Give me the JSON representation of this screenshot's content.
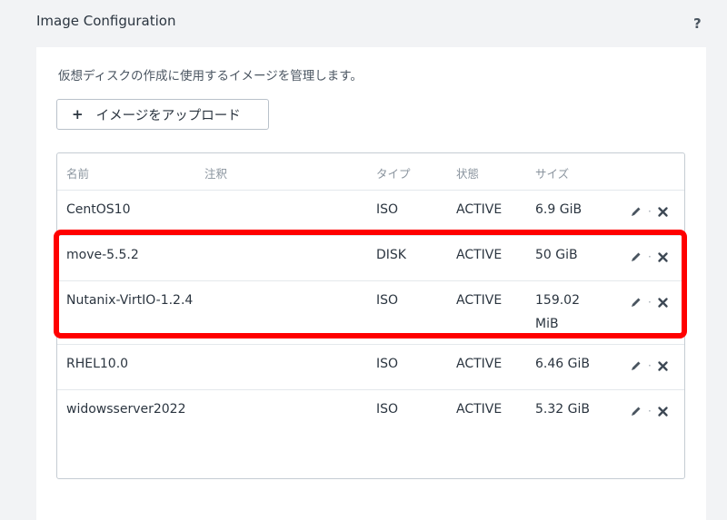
{
  "header": {
    "title": "Image Configuration",
    "help": "?"
  },
  "panel": {
    "description": "仮想ディスクの作成に使用するイメージを管理します。",
    "upload_button": {
      "icon": "plus-icon",
      "plus": "+",
      "label": "イメージをアップロード"
    }
  },
  "table": {
    "columns": {
      "name": "名前",
      "note": "注釈",
      "type": "タイプ",
      "state": "状態",
      "size": "サイズ"
    },
    "rows": [
      {
        "name": "CentOS10",
        "note": "",
        "type": "ISO",
        "state": "ACTIVE",
        "size_line1": "6.9 GiB",
        "size_line2": ""
      },
      {
        "name": "move-5.5.2",
        "note": "",
        "type": "DISK",
        "state": "ACTIVE",
        "size_line1": "50 GiB",
        "size_line2": ""
      },
      {
        "name": "Nutanix-VirtIO-1.2.4",
        "note": "",
        "type": "ISO",
        "state": "ACTIVE",
        "size_line1": "159.02",
        "size_line2": "MiB"
      },
      {
        "name": "RHEL10.0",
        "note": "",
        "type": "ISO",
        "state": "ACTIVE",
        "size_line1": "6.46 GiB",
        "size_line2": ""
      },
      {
        "name": "widowsserver2022",
        "note": "",
        "type": "ISO",
        "state": "ACTIVE",
        "size_line1": "5.32 GiB",
        "size_line2": ""
      }
    ],
    "action_separator": "·"
  },
  "colors": {
    "highlight": "#ff0000",
    "text": "#2b3540",
    "header_text": "#8a949e",
    "border": "#c5ccd3"
  }
}
